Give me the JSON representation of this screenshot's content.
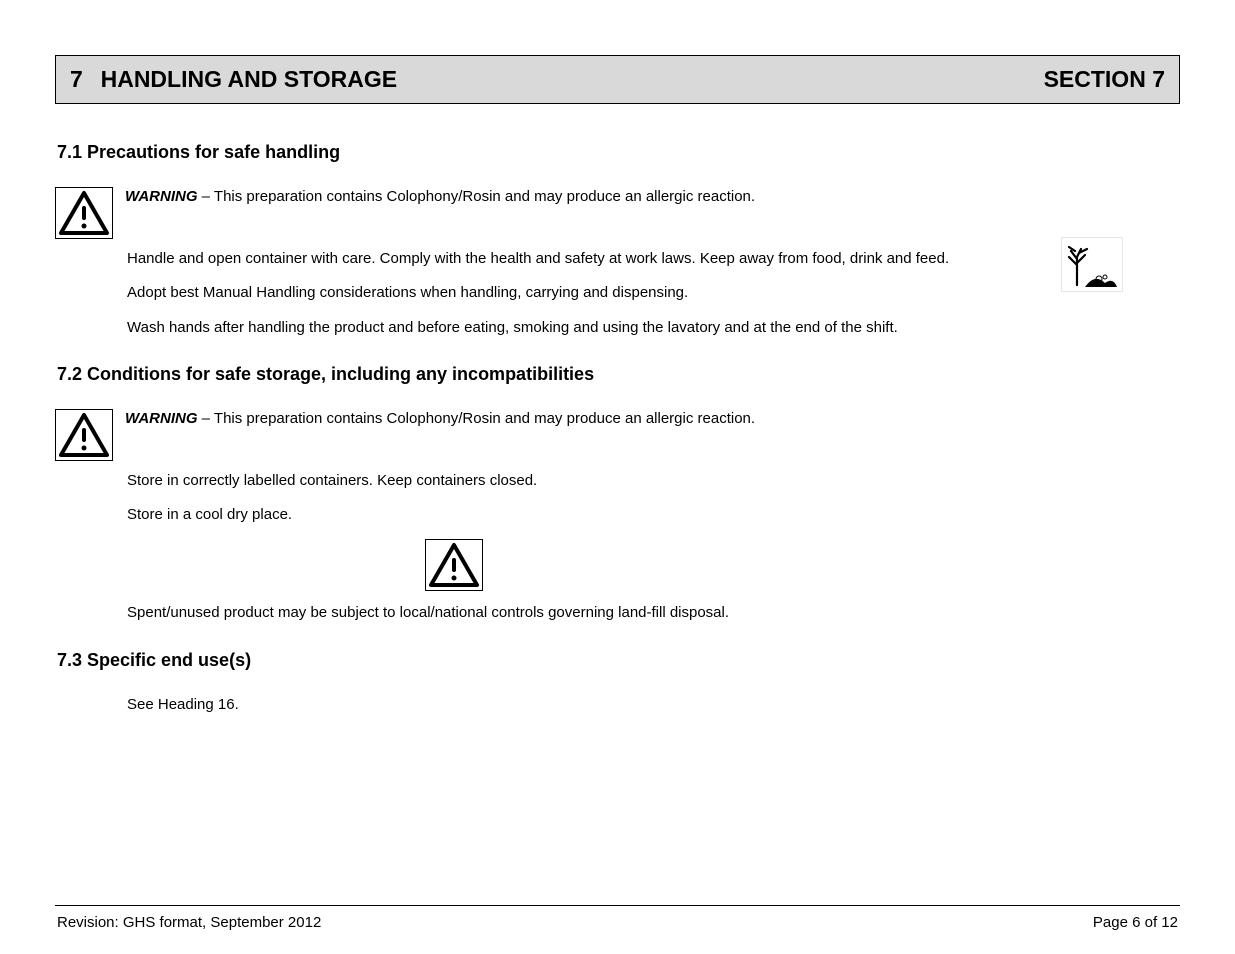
{
  "section": {
    "number": "7",
    "title": "HANDLING AND STORAGE",
    "right": "SECTION 7"
  },
  "sub1": {
    "title": "7.1 Precautions for safe handling",
    "warning_lead": "WARNING",
    "warning_text": " – This preparation contains Colophony/Rosin and may produce an allergic reaction.",
    "p1": "Handle and open container with care. Comply with the health and safety at work laws. Keep away from food, drink and feed.",
    "p2": "Adopt best Manual Handling considerations when handling, carrying and dispensing.",
    "p3": "Wash hands after handling the product and before eating, smoking and using the lavatory and at the end of the shift."
  },
  "sub2": {
    "title": "7.2 Conditions for safe storage, including any incompatibilities",
    "warning_lead": "WARNING",
    "warning_text": " – This preparation contains Colophony/Rosin and may produce an allergic reaction.",
    "p1": "Store in correctly labelled containers. Keep containers closed.",
    "p2": "Store in a cool dry place."
  },
  "environment_note": "Spent/unused product may be subject to local/national controls governing land-fill disposal.",
  "sub3": {
    "title": "7.3 Specific end use(s)",
    "p1": "See Heading 16."
  },
  "footer": {
    "left": "Revision: GHS format, September 2012",
    "right": "Page 6 of 12"
  }
}
